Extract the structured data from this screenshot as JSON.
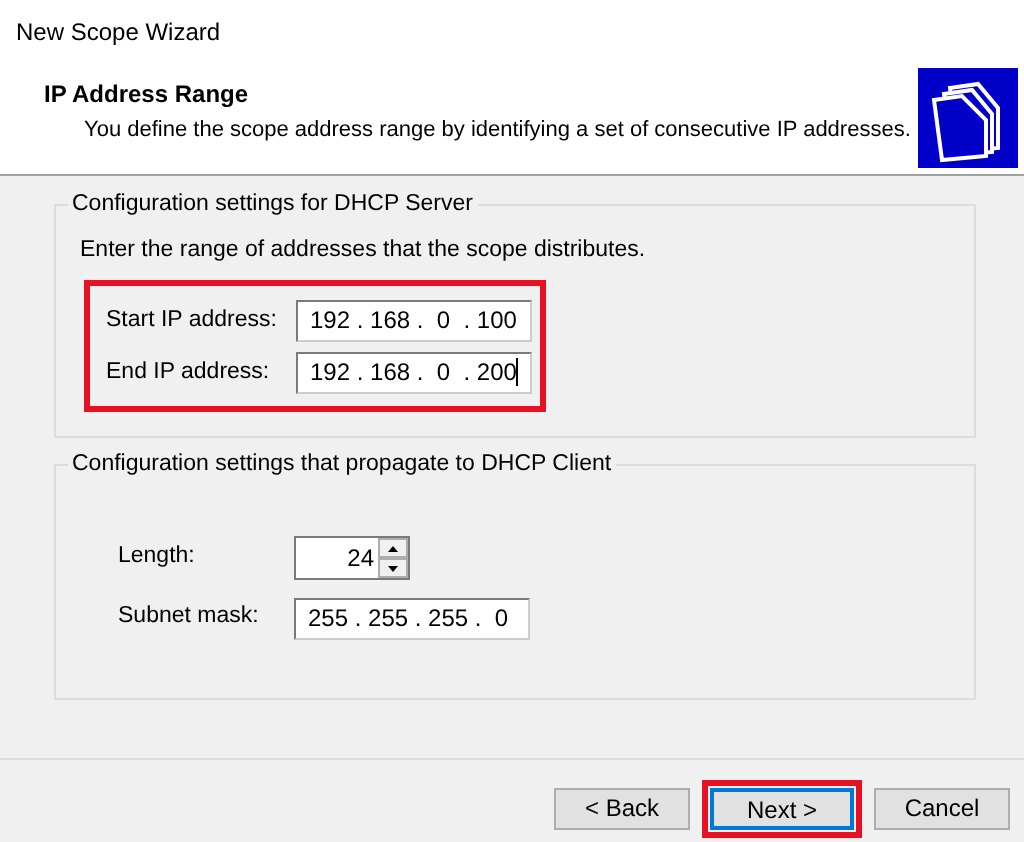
{
  "window": {
    "title": "New Scope Wizard"
  },
  "header": {
    "title": "IP Address Range",
    "subtitle": "You define the scope address range by identifying a set of consecutive IP addresses."
  },
  "server_group": {
    "legend": "Configuration settings for DHCP Server",
    "instruction": "Enter the range of addresses that the scope distributes.",
    "highlighted": true,
    "fields": [
      {
        "label": "Start IP address:",
        "value": "192 . 168 .  0  . 100",
        "focused": false
      },
      {
        "label": "End IP address:",
        "value": "192 . 168 .  0  . 200",
        "focused": true
      }
    ]
  },
  "client_group": {
    "legend": "Configuration settings that propagate to DHCP Client",
    "length": {
      "label": "Length:",
      "value": "24"
    },
    "subnet": {
      "label": "Subnet mask:",
      "value": "255 . 255 . 255 .  0"
    }
  },
  "buttons": [
    {
      "label": "< Back",
      "focused": false,
      "highlighted": false
    },
    {
      "label": "Next >",
      "focused": true,
      "highlighted": true
    },
    {
      "label": "Cancel",
      "focused": false,
      "highlighted": false
    }
  ]
}
